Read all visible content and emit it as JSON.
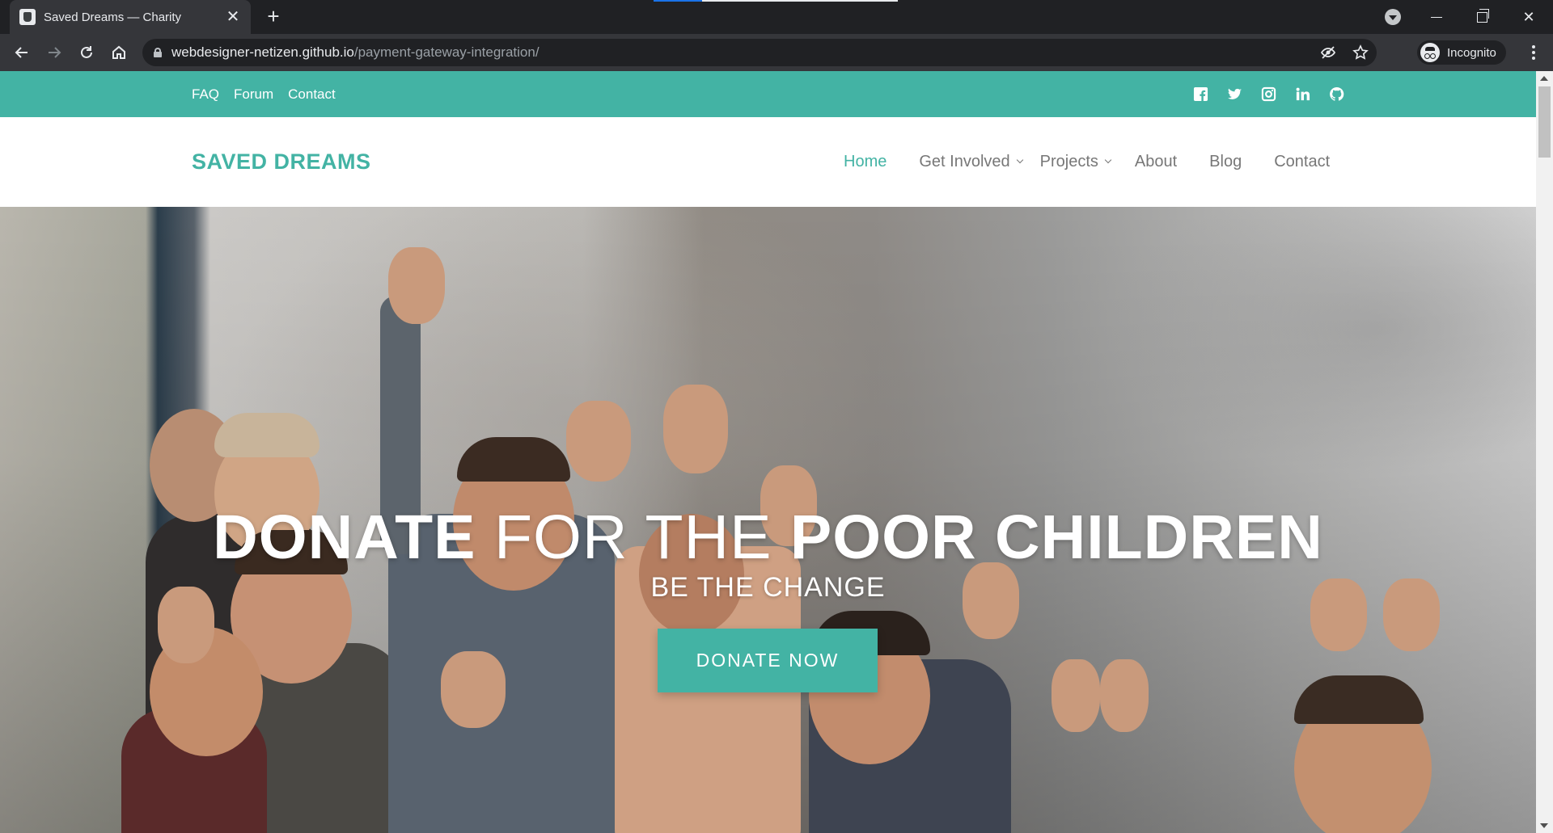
{
  "browser": {
    "tab_title": "Saved Dreams — Charity",
    "url_host": "webdesigner-netizen.github.io",
    "url_path": "/payment-gateway-integration/",
    "profile_label": "Incognito"
  },
  "topbar": {
    "links": [
      "FAQ",
      "Forum",
      "Contact"
    ],
    "social_icons": [
      "facebook-icon",
      "twitter-icon",
      "instagram-icon",
      "linkedin-icon",
      "github-icon"
    ]
  },
  "header": {
    "logo": "SAVED DREAMS",
    "nav": [
      {
        "label": "Home",
        "active": true,
        "dropdown": false
      },
      {
        "label": "Get Involved",
        "active": false,
        "dropdown": true
      },
      {
        "label": "Projects",
        "active": false,
        "dropdown": true
      },
      {
        "label": "About",
        "active": false,
        "dropdown": false
      },
      {
        "label": "Blog",
        "active": false,
        "dropdown": false
      },
      {
        "label": "Contact",
        "active": false,
        "dropdown": false
      }
    ]
  },
  "hero": {
    "title_bold_1": "DONATE",
    "title_thin": "FOR THE",
    "title_bold_2": "POOR CHILDREN",
    "subtitle": "BE THE CHANGE",
    "cta": "DONATE NOW"
  },
  "colors": {
    "accent": "#43b3a4",
    "nav_text": "#777777",
    "chrome_dark": "#202124",
    "chrome_toolbar": "#35363a"
  }
}
